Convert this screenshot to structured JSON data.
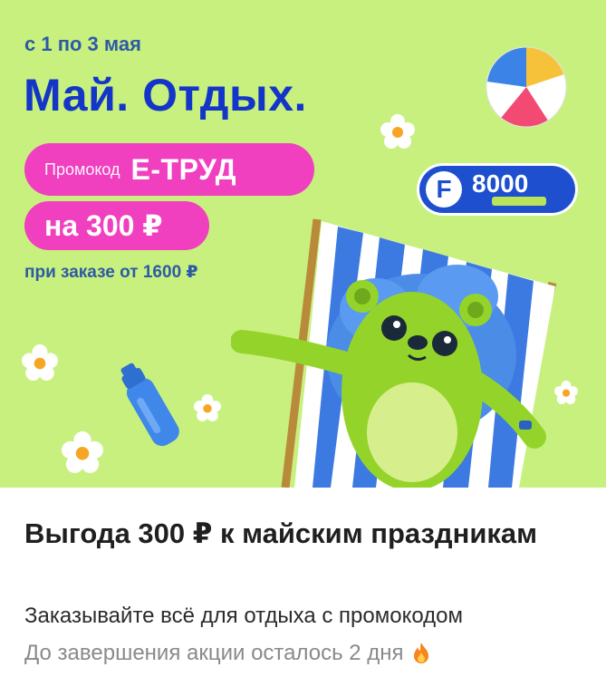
{
  "banner": {
    "date": "с 1 по 3 мая",
    "headline": "Май. Отдых.",
    "promo_label": "Промокод",
    "promo_code": "Е-ТРУД",
    "amount": "на 300 ₽",
    "min_order": "при заказе от 1600 ₽",
    "badge_letter": "F",
    "badge_value": "8000",
    "colors": {
      "background": "#c8f07e",
      "headline": "#1436c8",
      "pill": "#f03fbf",
      "badge": "#1d4fcf"
    }
  },
  "card": {
    "title": "Выгода 300 ₽ к майским праздникам",
    "subtitle": "Заказывайте всё для отдыха с промокодом",
    "countdown": "До завершения акции осталось 2 дня",
    "countdown_icon": "fire-icon"
  }
}
